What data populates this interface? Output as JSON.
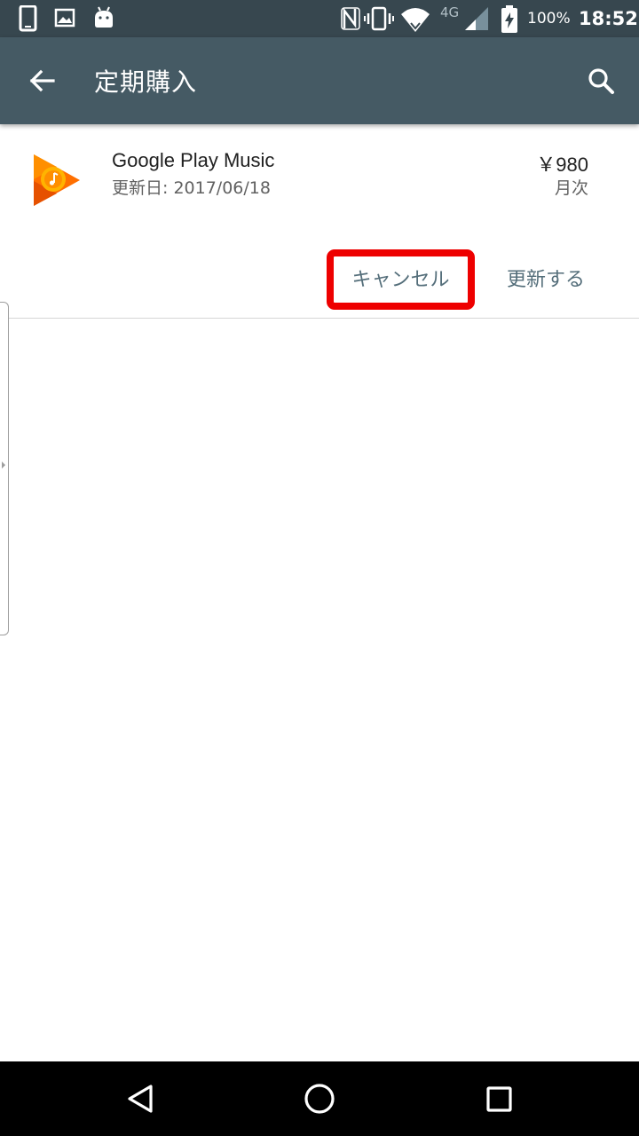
{
  "status_bar": {
    "network": "4G",
    "battery": "100%",
    "time": "18:52",
    "icons": [
      "phone-icon",
      "image-icon",
      "android-icon",
      "nfc-icon",
      "vibrate-icon",
      "wifi-icon",
      "signal-icon",
      "battery-charging-icon"
    ]
  },
  "app_bar": {
    "title": "定期購入",
    "back_icon": "arrow-back-icon",
    "search_icon": "search-icon"
  },
  "subscription": {
    "app_name": "Google Play Music",
    "renew_date": "更新日: 2017/06/18",
    "price": "￥980",
    "period": "月次",
    "icon": "google-play-music-icon",
    "cancel_label": "キャンセル",
    "update_label": "更新する",
    "highlight_color": "#ee0000"
  },
  "nav_bar": {
    "icons": [
      "back-triangle-icon",
      "home-circle-icon",
      "recents-square-icon"
    ]
  },
  "colors": {
    "status_bar": "#37474f",
    "app_bar": "#455a64",
    "button_text": "#546e7a",
    "music_orange": "#ff6f00",
    "music_yellow": "#ffb300"
  }
}
